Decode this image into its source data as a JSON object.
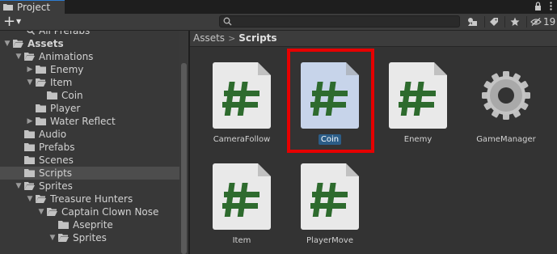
{
  "window": {
    "tab_title": "Project"
  },
  "toolbar": {
    "add_label": "+",
    "search": {
      "value": "",
      "placeholder": ""
    },
    "hidden_packages_count": "19"
  },
  "tree": {
    "items": [
      {
        "label": "All Prefabs",
        "indent": 1,
        "expanded": null,
        "icon": "search-icon"
      },
      {
        "label": "Assets",
        "indent": 0,
        "expanded": true,
        "icon": "folder-icon",
        "bold": true
      },
      {
        "label": "Animations",
        "indent": 1,
        "expanded": true,
        "icon": "folder-icon"
      },
      {
        "label": "Enemy",
        "indent": 2,
        "expanded": false,
        "icon": "folder-icon"
      },
      {
        "label": "Item",
        "indent": 2,
        "expanded": true,
        "icon": "folder-icon"
      },
      {
        "label": "Coin",
        "indent": 3,
        "expanded": null,
        "icon": "folder-icon"
      },
      {
        "label": "Player",
        "indent": 2,
        "expanded": null,
        "icon": "folder-icon"
      },
      {
        "label": "Water Reflect",
        "indent": 2,
        "expanded": false,
        "icon": "folder-icon"
      },
      {
        "label": "Audio",
        "indent": 1,
        "expanded": null,
        "icon": "folder-icon"
      },
      {
        "label": "Prefabs",
        "indent": 1,
        "expanded": null,
        "icon": "folder-icon"
      },
      {
        "label": "Scenes",
        "indent": 1,
        "expanded": null,
        "icon": "folder-icon"
      },
      {
        "label": "Scripts",
        "indent": 1,
        "expanded": null,
        "icon": "folder-icon",
        "selected": true
      },
      {
        "label": "Sprites",
        "indent": 1,
        "expanded": true,
        "icon": "folder-icon"
      },
      {
        "label": "Treasure Hunters",
        "indent": 2,
        "expanded": true,
        "icon": "folder-icon"
      },
      {
        "label": "Captain Clown Nose",
        "indent": 3,
        "expanded": true,
        "icon": "folder-icon"
      },
      {
        "label": "Aseprite",
        "indent": 4,
        "expanded": null,
        "icon": "folder-icon"
      },
      {
        "label": "Sprites",
        "indent": 4,
        "expanded": true,
        "icon": "folder-icon"
      }
    ]
  },
  "breadcrumb": {
    "root": "Assets",
    "separator": ">",
    "current": "Scripts"
  },
  "assets": [
    {
      "name": "CameraFollow",
      "type": "script",
      "selected": false
    },
    {
      "name": "Coin",
      "type": "script",
      "selected": true
    },
    {
      "name": "Enemy",
      "type": "script",
      "selected": false
    },
    {
      "name": "GameManager",
      "type": "gear",
      "selected": false
    },
    {
      "name": "Item",
      "type": "script",
      "selected": false
    },
    {
      "name": "PlayerMove",
      "type": "script",
      "selected": false
    }
  ],
  "colors": {
    "highlight": "#e60000",
    "selection": "#2c5d87",
    "script_hash": "#2e6b2e",
    "script_page": "#e9e9e9",
    "script_page_selected": "#c7d4ea"
  }
}
